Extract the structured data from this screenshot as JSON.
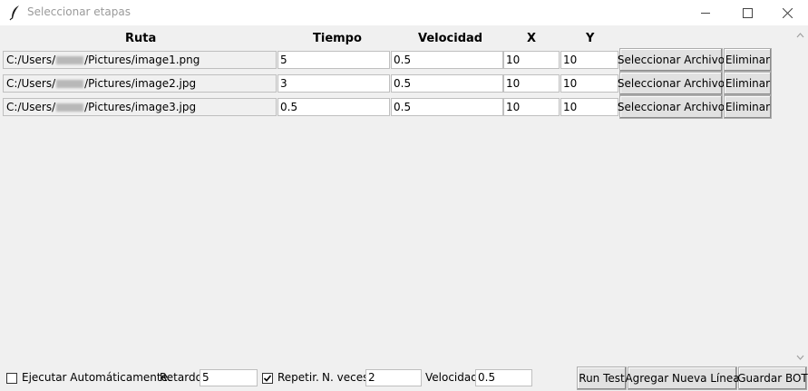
{
  "window": {
    "title": "Seleccionar etapas",
    "icon": "feather-icon",
    "controls": [
      "minimize-icon",
      "maximize-icon",
      "close-icon"
    ]
  },
  "headers": {
    "ruta": "Ruta",
    "tiempo": "Tiempo",
    "velocidad": "Velocidad",
    "x": "X",
    "y": "Y"
  },
  "rows": [
    {
      "path_prefix": "C:/Users/",
      "path_suffix": "/Pictures/image1.png",
      "tiempo": "5",
      "velocidad": "0.5",
      "x": "10",
      "y": "10",
      "select_label": "Seleccionar Archivo",
      "delete_label": "Eliminar"
    },
    {
      "path_prefix": "C:/Users/",
      "path_suffix": "/Pictures/image2.jpg",
      "tiempo": "3",
      "velocidad": "0.5",
      "x": "10",
      "y": "10",
      "select_label": "Seleccionar Archivo",
      "delete_label": "Eliminar"
    },
    {
      "path_prefix": "C:/Users/",
      "path_suffix": "/Pictures/image3.jpg",
      "tiempo": "0.5",
      "velocidad": "0.5",
      "x": "10",
      "y": "10",
      "select_label": "Seleccionar Archivo",
      "delete_label": "Eliminar"
    }
  ],
  "bottom": {
    "auto_label": "Ejecutar Automáticamente.",
    "auto_checked": false,
    "retardo_label": "Retardo",
    "retardo_value": "5",
    "repetir_label": "Repetir.",
    "repetir_checked": true,
    "nveces_label": "N. veces",
    "nveces_value": "2",
    "velocidad_label": "Velocidad",
    "velocidad_value": "0.5",
    "run_test_label": "Run Test",
    "add_line_label": "Agregar Nueva Línea",
    "save_label": "Guardar BOT"
  }
}
